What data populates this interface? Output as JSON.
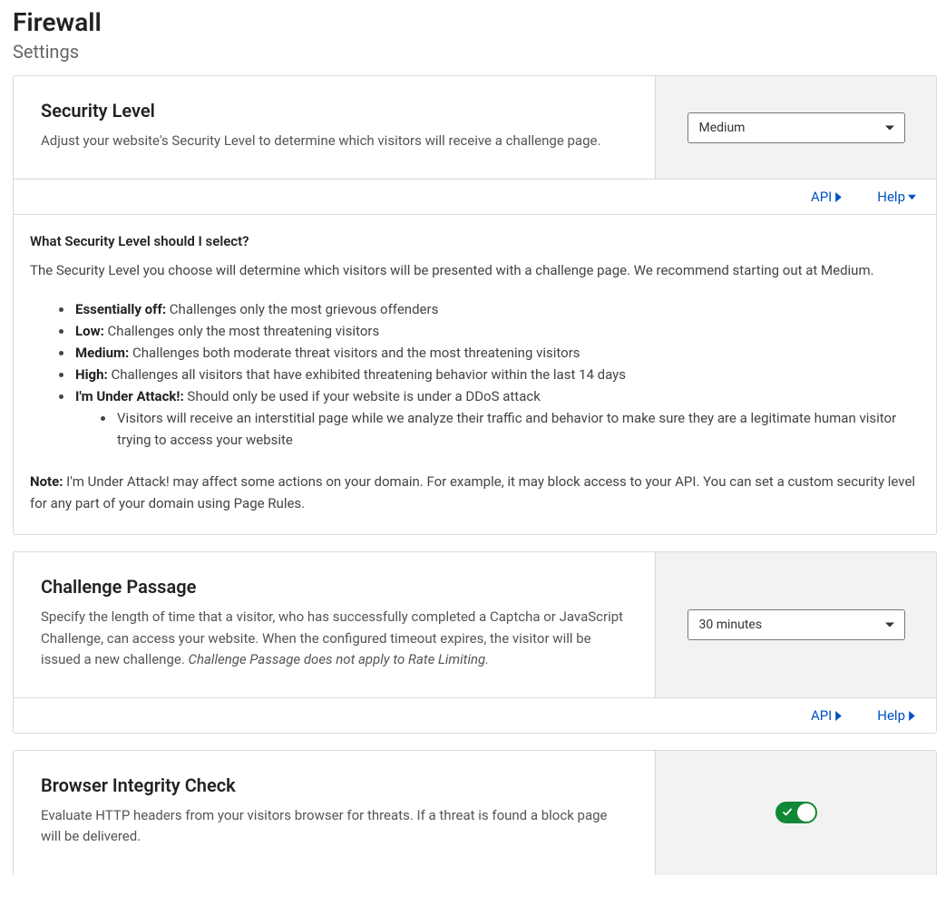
{
  "page": {
    "title": "Firewall",
    "subtitle": "Settings"
  },
  "footer": {
    "api": "API",
    "help": "Help"
  },
  "securityLevel": {
    "title": "Security Level",
    "desc": "Adjust your website's Security Level to determine which visitors will receive a challenge page.",
    "selected": "Medium",
    "help": {
      "question": "What Security Level should I select?",
      "intro": "The Security Level you choose will determine which visitors will be presented with a challenge page. We recommend starting out at Medium.",
      "items": {
        "essOffLabel": "Essentially off:",
        "essOffText": " Challenges only the most grievous offenders",
        "lowLabel": "Low:",
        "lowText": " Challenges only the most threatening visitors",
        "medLabel": "Medium:",
        "medText": " Challenges both moderate threat visitors and the most threatening visitors",
        "highLabel": "High:",
        "highText": " Challenges all visitors that have exhibited threatening behavior within the last 14 days",
        "attackLabel": "I'm Under Attack!:",
        "attackText": " Should only be used if your website is under a DDoS attack",
        "attackSub": "Visitors will receive an interstitial page while we analyze their traffic and behavior to make sure they are a legitimate human visitor trying to access your website"
      },
      "noteLabel": "Note:",
      "noteText": " I'm Under Attack! may affect some actions on your domain. For example, it may block access to your API. You can set a custom security level for any part of your domain using Page Rules."
    }
  },
  "challengePassage": {
    "title": "Challenge Passage",
    "descPlain": "Specify the length of time that a visitor, who has successfully completed a Captcha or JavaScript Challenge, can access your website. When the configured timeout expires, the visitor will be issued a new challenge. ",
    "descItalic": "Challenge Passage does not apply to Rate Limiting.",
    "selected": "30 minutes"
  },
  "browserIntegrity": {
    "title": "Browser Integrity Check",
    "desc": "Evaluate HTTP headers from your visitors browser for threats. If a threat is found a block page will be delivered.",
    "enabled": true
  }
}
